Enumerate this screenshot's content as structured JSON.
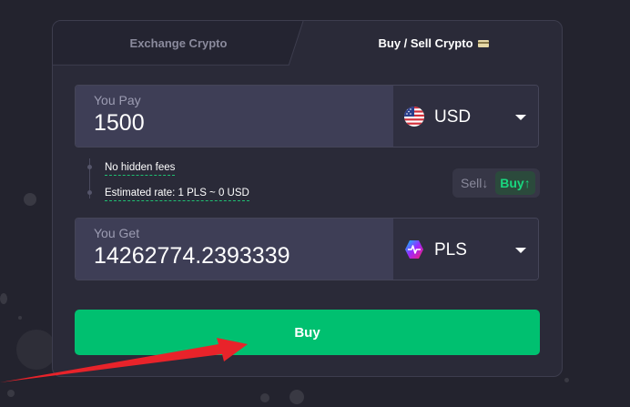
{
  "tabs": {
    "exchange_label": "Exchange Crypto",
    "buy_sell_label": "Buy / Sell Crypto",
    "active": "buy_sell"
  },
  "pay": {
    "label": "You Pay",
    "value": "1500",
    "currency": "USD",
    "currency_icon": "us-flag-icon"
  },
  "info": {
    "fees": "No hidden fees",
    "rate": "Estimated rate: 1 PLS ~ 0 USD"
  },
  "toggle": {
    "sell_label": "Sell",
    "sell_icon": "↓",
    "buy_label": "Buy",
    "buy_icon": "↑",
    "selected": "buy"
  },
  "get": {
    "label": "You Get",
    "value": "14262774.2393339",
    "currency": "PLS",
    "currency_icon": "pulsechain-icon"
  },
  "buy_button_label": "Buy",
  "colors": {
    "accent_green": "#00c070",
    "arrow_red": "#e8232a",
    "panel": "#2a2a38",
    "input_bg": "#3e3e56"
  }
}
